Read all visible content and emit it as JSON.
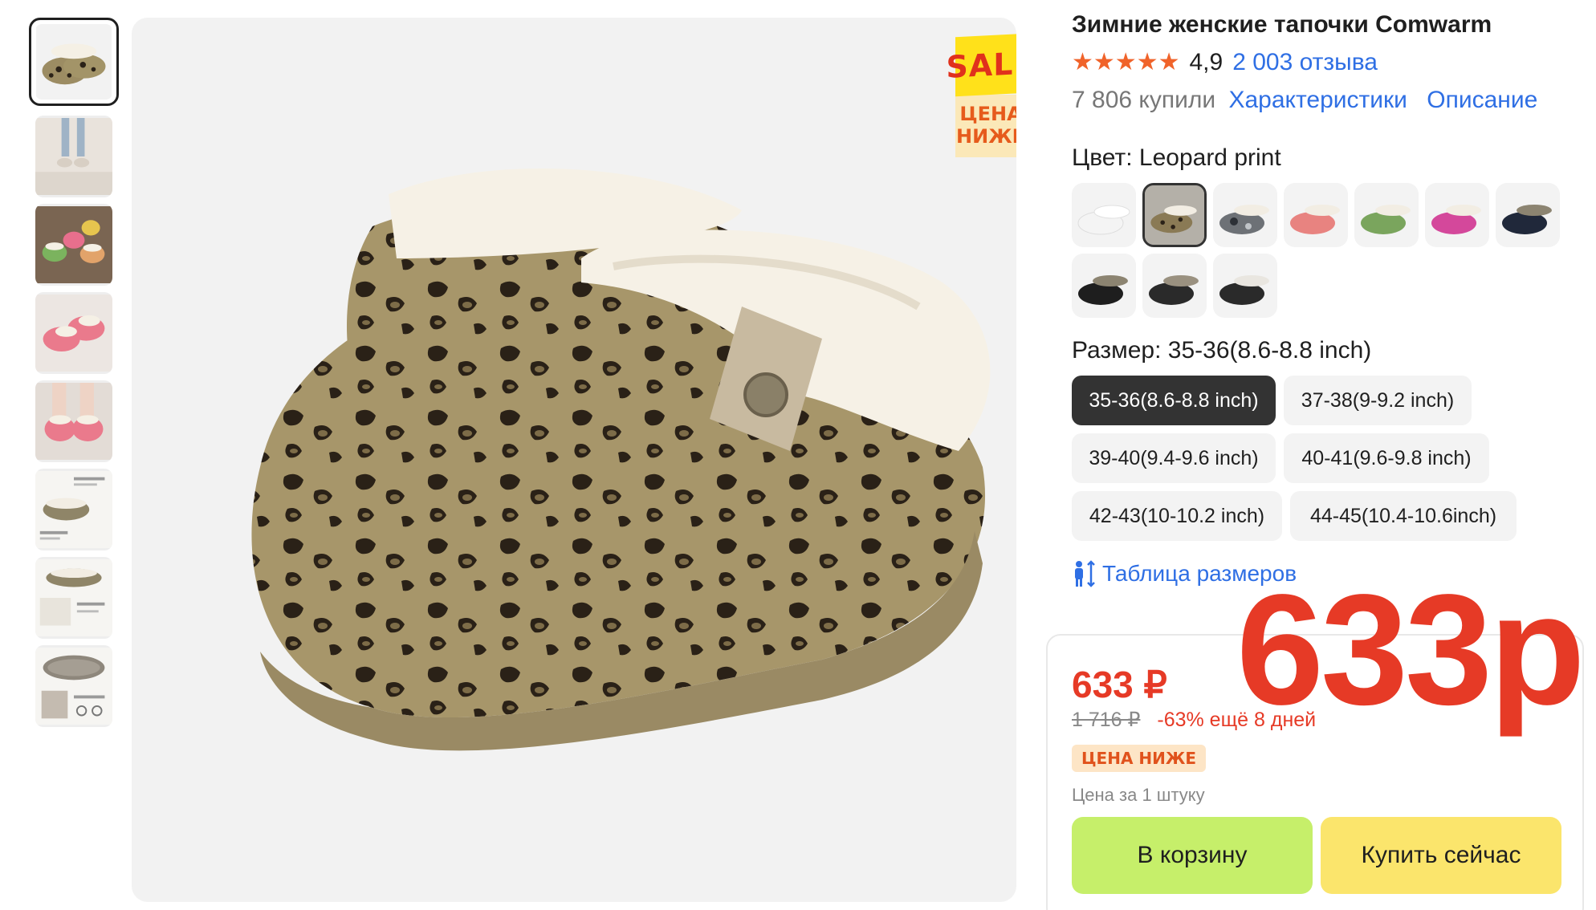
{
  "product": {
    "title": "Зимние женские тапочки Comwarm",
    "stars": "★★★★★",
    "rating": "4,9",
    "reviews_link": "2 003 отзыва",
    "bought": "7 806 купили",
    "characteristics_link": "Характеристики",
    "description_link": "Описание"
  },
  "gallery": {
    "thumbnails": [
      {
        "icon": "leopard-clog"
      },
      {
        "icon": "slippers-on-carpet"
      },
      {
        "icon": "colorful-slippers"
      },
      {
        "icon": "pink-slippers"
      },
      {
        "icon": "pink-slippers-worn"
      },
      {
        "icon": "feature-infographic"
      },
      {
        "icon": "memory-foam-infographic"
      },
      {
        "icon": "sole-infographic"
      }
    ],
    "sale_badge": {
      "top": "SALE",
      "line1": "ЦЕНА",
      "line2": "НИЖЕ"
    }
  },
  "color": {
    "label": "Цвет: Leopard print",
    "swatches": [
      {
        "name": "white",
        "color": "#f4f4f4",
        "fur": "#ffffff"
      },
      {
        "name": "leopard-print",
        "color": "#8a7a55",
        "fur": "#f2ede3",
        "selected": true
      },
      {
        "name": "camo-grey",
        "color": "#6d7176",
        "fur": "#f2ede3"
      },
      {
        "name": "coral-pink",
        "color": "#e88380",
        "fur": "#f2ede3"
      },
      {
        "name": "green",
        "color": "#7aa55d",
        "fur": "#f2ede3"
      },
      {
        "name": "magenta",
        "color": "#d4489b",
        "fur": "#f2ede3"
      },
      {
        "name": "navy",
        "color": "#20283a",
        "fur": "#8c8471"
      },
      {
        "name": "black-grey",
        "color": "#1e1e1e",
        "fur": "#8c8471"
      },
      {
        "name": "black-grey-2",
        "color": "#2a2a2a",
        "fur": "#9a9180"
      },
      {
        "name": "black-white",
        "color": "#2a2a2a",
        "fur": "#e9e6e0"
      }
    ]
  },
  "size": {
    "label": "Размер: 35-36(8.6-8.8 inch)",
    "options": [
      "35-36(8.6-8.8 inch)",
      "37-38(9-9.2 inch)",
      "39-40(9.4-9.6 inch)",
      "40-41(9.6-9.8 inch)",
      "42-43(10-10.2 inch)",
      "44-45(10.4-10.6inch)"
    ],
    "selected": "35-36(8.6-8.8 inch)",
    "table_link": "Таблица размеров"
  },
  "price": {
    "current": "633 ₽",
    "old": "1 716 ₽",
    "discount": "-63% ещё 8 дней",
    "badge": "ЦЕНА НИЖЕ",
    "per_unit": "Цена за 1 штуку",
    "big_overlay": "633р"
  },
  "actions": {
    "cart": "В корзину",
    "buy_now": "Купить сейчас"
  },
  "colors": {
    "accent_red": "#e63a26",
    "link_blue": "#2f6fe4",
    "star_orange": "#f0632a",
    "cart_green": "#c6ef6a",
    "buy_yellow": "#fbe56c"
  }
}
